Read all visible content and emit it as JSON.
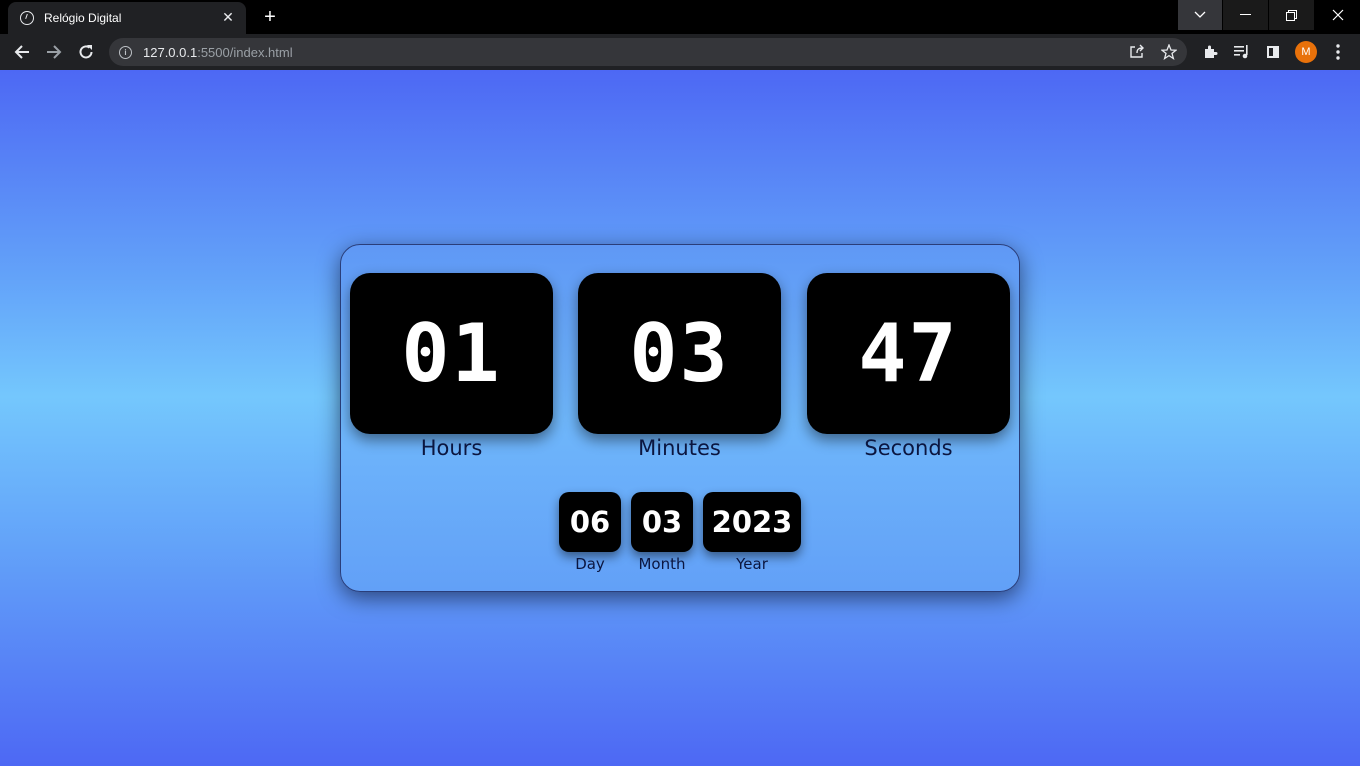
{
  "browser": {
    "tab_title": "Relógio Digital",
    "tab_close": "✕",
    "new_tab": "+",
    "url_host": "127.0.0.1",
    "url_rest": ":5500/index.html",
    "profile_initial": "M"
  },
  "clock": {
    "hours": "01",
    "minutes": "03",
    "seconds": "47",
    "hours_label": "Hours",
    "minutes_label": "Minutes",
    "seconds_label": "Seconds"
  },
  "date": {
    "day": "06",
    "month": "03",
    "year": "2023",
    "day_label": "Day",
    "month_label": "Month",
    "year_label": "Year"
  },
  "colors": {
    "page_gradient_edge": "#4d68f4",
    "page_gradient_center": "#74c7fd",
    "digit_box": "#000000",
    "label_text": "#0b1640"
  }
}
